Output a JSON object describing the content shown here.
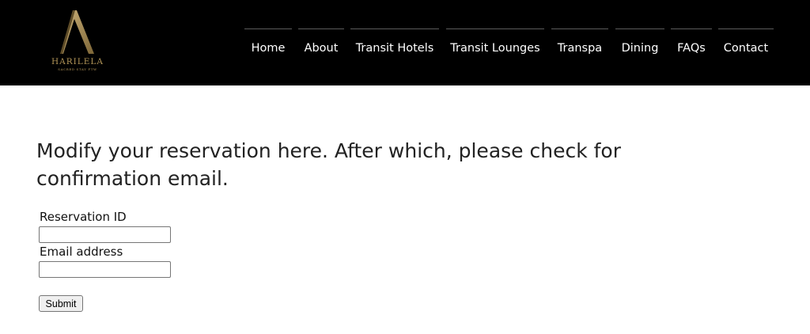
{
  "brand": {
    "name": "HARILELA",
    "tagline": "SACRED STAY FTW",
    "gold": "#b39658"
  },
  "nav": {
    "items": [
      {
        "label": "Home",
        "name": "nav-home"
      },
      {
        "label": "About",
        "name": "nav-about"
      },
      {
        "label": "Transit Hotels",
        "name": "nav-transit-hotels"
      },
      {
        "label": "Transit Lounges",
        "name": "nav-transit-lounges"
      },
      {
        "label": "Transpa",
        "name": "nav-transpa"
      },
      {
        "label": "Dining",
        "name": "nav-dining"
      },
      {
        "label": "FAQs",
        "name": "nav-faqs"
      },
      {
        "label": "Contact",
        "name": "nav-contact"
      }
    ]
  },
  "main": {
    "heading_line1": "Modify your reservation here. After which, please check for",
    "heading_line2": "confirmation email."
  },
  "form": {
    "reservation_id_label": "Reservation ID",
    "reservation_id_value": "",
    "email_label": "Email address",
    "email_value": "",
    "submit_label": "Submit"
  }
}
